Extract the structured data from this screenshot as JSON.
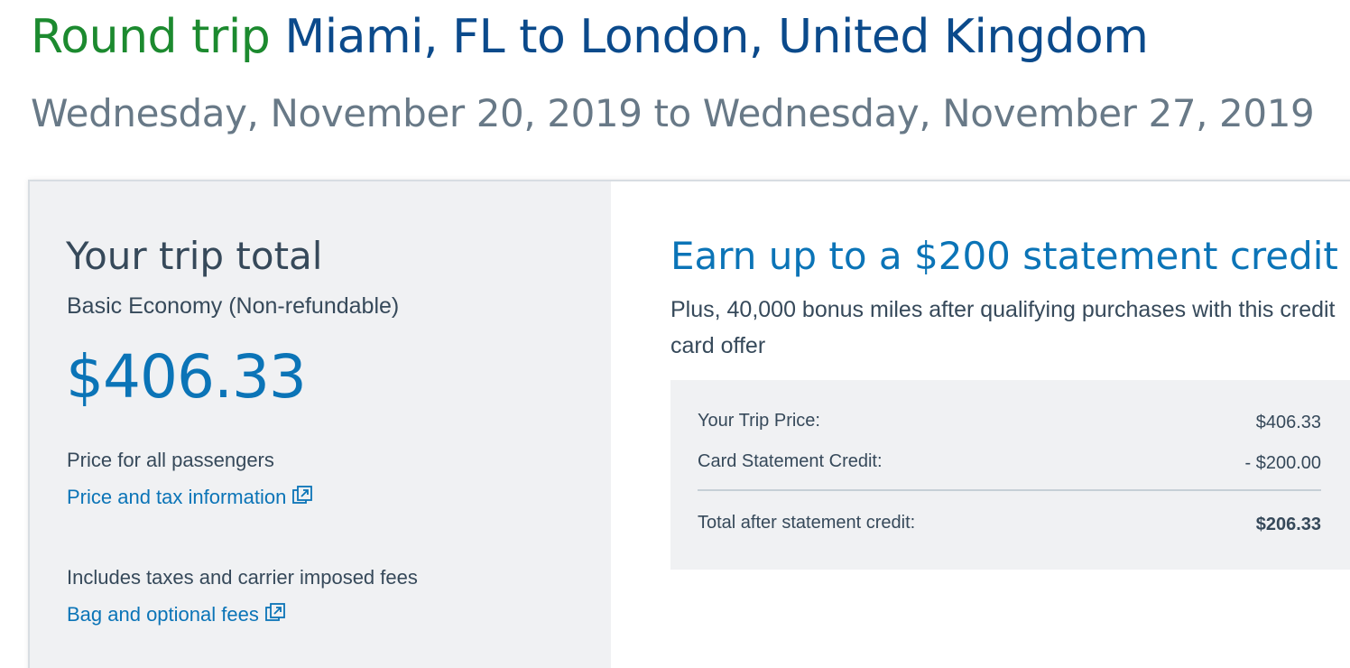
{
  "header": {
    "trip_type": "Round trip",
    "route": "Miami, FL to London, United Kingdom",
    "dates": "Wednesday, November 20, 2019 to Wednesday, November 27, 2019"
  },
  "summary": {
    "title": "Your trip total",
    "fare_type": "Basic Economy (Non-refundable)",
    "total": "$406.33",
    "price_note": "Price for all passengers",
    "price_tax_link": "Price and tax information",
    "fees_note": "Includes taxes and carrier imposed fees",
    "bag_fees_link": "Bag and optional fees",
    "link_icon": "external-link-icon"
  },
  "offer": {
    "title": "Earn up to a $200 statement credit",
    "subtitle": "Plus, 40,000 bonus miles after qualifying purchases with this credit card offer",
    "rows": [
      {
        "label": "Your Trip Price:",
        "value": "$406.33"
      },
      {
        "label": "Card Statement Credit:",
        "value": "- $200.00"
      },
      {
        "label": "Total after statement credit:",
        "value": "$206.33"
      }
    ]
  },
  "colors": {
    "trip_type": "#1c8a2f",
    "route": "#0b4a8b",
    "link": "#0b74b7",
    "panel_bg": "#f0f1f3",
    "text": "#36495a"
  }
}
